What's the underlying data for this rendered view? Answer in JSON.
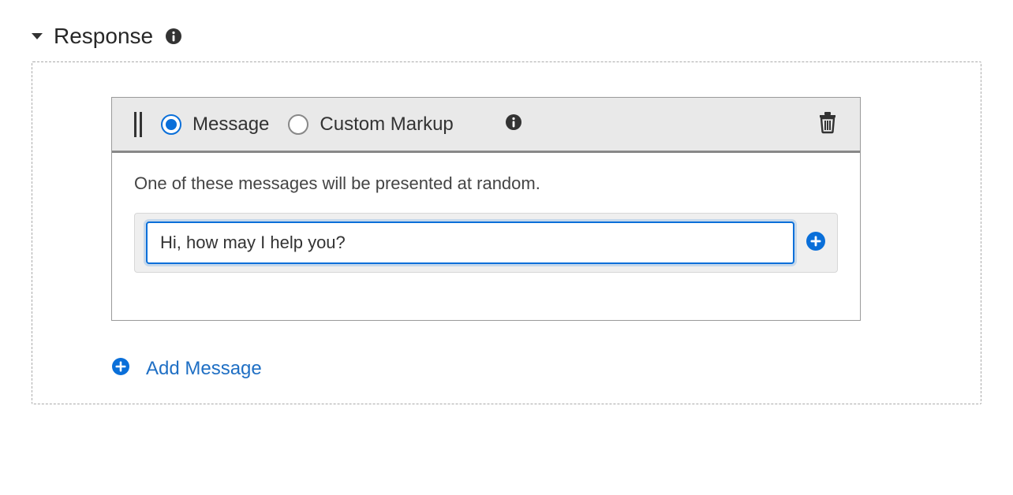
{
  "section": {
    "title": "Response"
  },
  "card": {
    "options": {
      "message": "Message",
      "custom_markup": "Custom Markup"
    },
    "helper_text": "One of these messages will be presented at random.",
    "input_value": "Hi, how may I help you?"
  },
  "actions": {
    "add_message": "Add Message"
  },
  "colors": {
    "accent": "#0a6fd9"
  }
}
